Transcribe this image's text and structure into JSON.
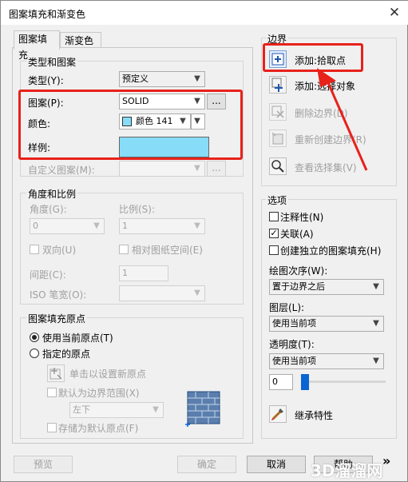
{
  "window": {
    "title": "图案填充和渐变色",
    "close": "✕"
  },
  "tabs": [
    {
      "label": "图案填充"
    },
    {
      "label": "渐变色"
    }
  ],
  "type_pattern": {
    "group_title": "类型和图案",
    "type_label": "类型(Y):",
    "type_value": "预定义",
    "pattern_label": "图案(P):",
    "pattern_value": "SOLID",
    "pattern_browse": "...",
    "color_label": "颜色:",
    "color_value": "颜色  141",
    "color_swatch": "#87dcf8",
    "sample_label": "样例:",
    "sample_color": "#87dcf8",
    "custom_label": "自定义图案(M):",
    "custom_browse": "..."
  },
  "angle_scale": {
    "group_title": "角度和比例",
    "angle_label": "角度(G):",
    "angle_value": "0",
    "scale_label": "比例(S):",
    "scale_value": "1",
    "double_label": "双向(U)",
    "relative_label": "相对图纸空间(E)",
    "spacing_label": "间距(C):",
    "spacing_value": "1",
    "iso_label": "ISO 笔宽(O):"
  },
  "origin": {
    "group_title": "图案填充原点",
    "use_current_label": "使用当前原点(T)",
    "specified_label": "指定的原点",
    "click_set_label": "单击以设置新原点",
    "default_boundary_label": "默认为边界范围(X)",
    "position_value": "左下",
    "store_default_label": "存储为默认原点(F)"
  },
  "boundaries": {
    "group_title": "边界",
    "add_pick_label": "添加:拾取点",
    "add_select_label": "添加:选择对象",
    "remove_label": "删除边界(D)",
    "recreate_label": "重新创建边界(R)",
    "view_sel_label": "查看选择集(V)"
  },
  "options": {
    "group_title": "选项",
    "annotative_label": "注释性(N)",
    "associative_label": "关联(A)",
    "separate_label": "创建独立的图案填充(H)",
    "draw_order_label": "绘图次序(W):",
    "draw_order_value": "置于边界之后",
    "layer_label": "图层(L):",
    "layer_value": "使用当前项",
    "transparency_label": "透明度(T):",
    "transparency_value": "使用当前项",
    "transparency_number": "0",
    "inherit_label": "继承特性"
  },
  "footer": {
    "preview": "预览",
    "ok": "确定",
    "cancel": "取消",
    "help": "帮助",
    "more": "»",
    "watermark": "3D溜溜网"
  },
  "colors": {
    "highlight": "#e8211b",
    "accent_blue": "#0a64d2"
  }
}
